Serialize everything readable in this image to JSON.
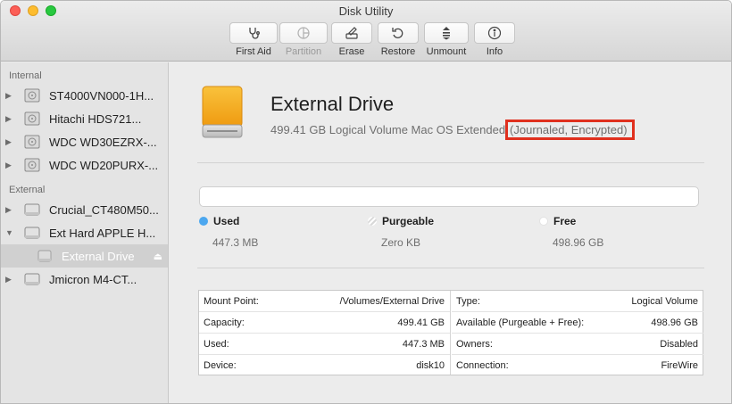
{
  "window": {
    "title": "Disk Utility"
  },
  "toolbar": [
    {
      "label": "First Aid",
      "icon": "stethoscope-icon",
      "enabled": true
    },
    {
      "label": "Partition",
      "icon": "partition-pie-icon",
      "enabled": false
    },
    {
      "label": "Erase",
      "icon": "erase-drive-icon",
      "enabled": true
    },
    {
      "label": "Restore",
      "icon": "restore-arrow-icon",
      "enabled": true
    },
    {
      "label": "Unmount",
      "icon": "unmount-icon",
      "enabled": true
    },
    {
      "label": "Info",
      "icon": "info-icon",
      "enabled": true
    }
  ],
  "sidebar": {
    "internal_label": "Internal",
    "internal": [
      {
        "label": "ST4000VN000-1H..."
      },
      {
        "label": "Hitachi HDS721..."
      },
      {
        "label": "WDC WD30EZRX-..."
      },
      {
        "label": "WDC WD20PURX-..."
      }
    ],
    "external_label": "External",
    "external": [
      {
        "label": "Crucial_CT480M50..."
      },
      {
        "label": "Ext Hard APPLE H..."
      },
      {
        "label": "External Drive",
        "selected": true
      },
      {
        "label": "Jmicron M4-CT..."
      }
    ]
  },
  "volume": {
    "name": "External Drive",
    "subtitle": "499.41 GB Logical Volume Mac OS Extended",
    "format_highlight": "(Journaled, Encrypted)"
  },
  "usage": {
    "used_label": "Used",
    "used_value": "447.3 MB",
    "purgeable_label": "Purgeable",
    "purgeable_value": "Zero KB",
    "free_label": "Free",
    "free_value": "498.96 GB"
  },
  "info_left": [
    {
      "key": "Mount Point:",
      "value": "/Volumes/External Drive"
    },
    {
      "key": "Capacity:",
      "value": "499.41 GB"
    },
    {
      "key": "Used:",
      "value": "447.3 MB"
    },
    {
      "key": "Device:",
      "value": "disk10"
    }
  ],
  "info_right": [
    {
      "key": "Type:",
      "value": "Logical Volume"
    },
    {
      "key": "Available (Purgeable + Free):",
      "value": "498.96 GB"
    },
    {
      "key": "Owners:",
      "value": "Disabled"
    },
    {
      "key": "Connection:",
      "value": "FireWire"
    }
  ],
  "colors": {
    "used": "#4ca7ef",
    "highlight_box": "#e0301e",
    "drive_orange": "#f5a623"
  }
}
